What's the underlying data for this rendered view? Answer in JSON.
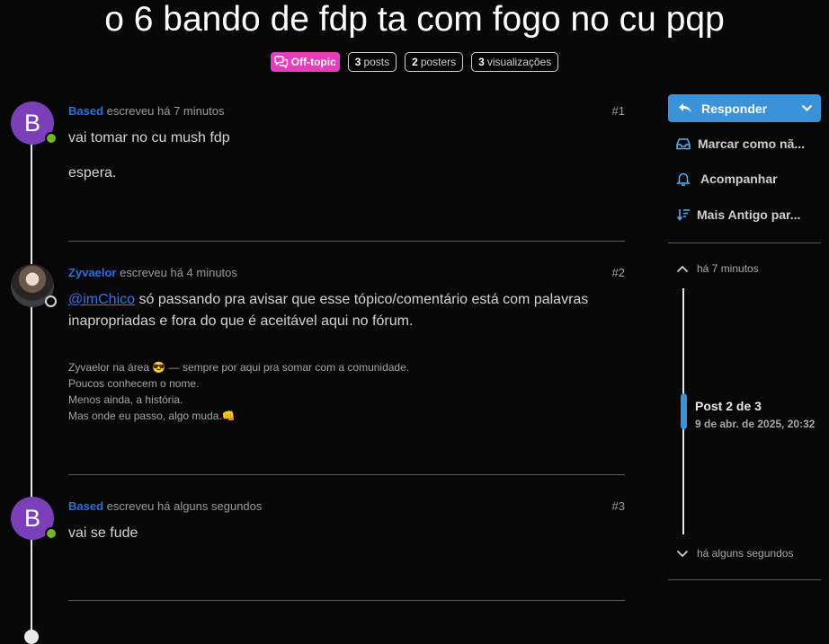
{
  "topic": {
    "title": "o 6 bando de fdp ta com fogo no cu pqp",
    "category": "Off-topic",
    "stats": [
      {
        "count": "3",
        "label": "posts"
      },
      {
        "count": "2",
        "label": "posters"
      },
      {
        "count": "3",
        "label": "visualizações"
      }
    ]
  },
  "posts": [
    {
      "user": "Based",
      "avatar_letter": "B",
      "action": "escreveu há 7 minutos",
      "number": "#1",
      "body": [
        "vai tomar no cu mush fdp",
        "espera."
      ]
    },
    {
      "user": "Zyvaelor",
      "action": "escreveu há 4 minutos",
      "number": "#2",
      "mention": "@imChico",
      "body_text": " só passando pra avisar que esse tópico/comentário está com palavras inapropriadas e fora do que é aceitável aqui no fórum.",
      "signature": [
        "Zyvaelor na área 😎 — sempre por aqui pra somar com a comunidade.",
        "Poucos conhecem o nome.",
        "Menos ainda, a história.",
        "Mas onde eu passo, algo muda.👊"
      ]
    },
    {
      "user": "Based",
      "avatar_letter": "B",
      "action": "escreveu há alguns segundos",
      "number": "#3",
      "body": [
        "vai se fude"
      ]
    }
  ],
  "sidebar": {
    "reply_label": "Responder",
    "actions": [
      "Marcar como nã...",
      "Acompanhar",
      "Mais Antigo par..."
    ],
    "timeline": {
      "top_date": "há 7 minutos",
      "position_label": "Post 2 de 3",
      "position_date": "9 de abr. de 2025, 20:32",
      "bottom_date": "há alguns segundos"
    }
  },
  "colors": {
    "accent": "#3a92d8",
    "category": "#e63dbd",
    "online": "#78b626",
    "username": "#2d6de3"
  }
}
